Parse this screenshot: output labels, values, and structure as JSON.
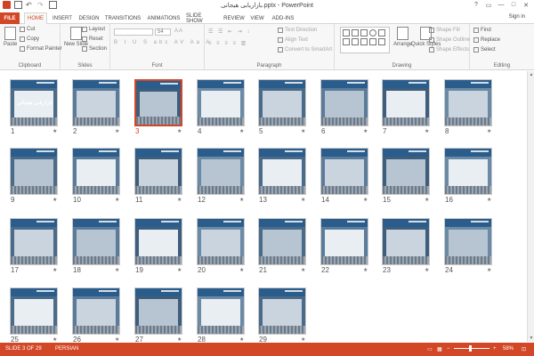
{
  "window": {
    "title": "بازاریابی هیجانی.pptx - PowerPoint",
    "controls": [
      "?",
      "▭",
      "—",
      "□",
      "✕"
    ]
  },
  "tabs": [
    {
      "label": "FILE"
    },
    {
      "label": "HOME"
    },
    {
      "label": "INSERT"
    },
    {
      "label": "DESIGN"
    },
    {
      "label": "TRANSITIONS"
    },
    {
      "label": "ANIMATIONS"
    },
    {
      "label": "SLIDE SHOW"
    },
    {
      "label": "REVIEW"
    },
    {
      "label": "VIEW"
    },
    {
      "label": "ADD-INS"
    }
  ],
  "signin": "Sign in",
  "ribbon": {
    "clipboard": {
      "label": "Clipboard",
      "paste": "Paste",
      "cut": "Cut",
      "copy": "Copy",
      "format_painter": "Format Painter"
    },
    "slides": {
      "label": "Slides",
      "new_slide": "New Slide",
      "layout": "Layout",
      "reset": "Reset",
      "section": "Section"
    },
    "font": {
      "label": "Font",
      "size": "54"
    },
    "paragraph": {
      "label": "Paragraph",
      "text_direction": "Text Direction",
      "align_text": "Align Text",
      "convert_smartart": "Convert to SmartArt"
    },
    "drawing": {
      "label": "Drawing",
      "arrange": "Arrange",
      "quick_styles": "Quick Styles",
      "shape_fill": "Shape Fill",
      "shape_outline": "Shape Outline",
      "shape_effects": "Shape Effects"
    },
    "editing": {
      "label": "Editing",
      "find": "Find",
      "replace": "Replace",
      "select": "Select"
    }
  },
  "slides": [
    {
      "n": "1"
    },
    {
      "n": "2"
    },
    {
      "n": "3"
    },
    {
      "n": "4"
    },
    {
      "n": "5"
    },
    {
      "n": "6"
    },
    {
      "n": "7"
    },
    {
      "n": "8"
    },
    {
      "n": "9"
    },
    {
      "n": "10"
    },
    {
      "n": "11"
    },
    {
      "n": "12"
    },
    {
      "n": "13"
    },
    {
      "n": "14"
    },
    {
      "n": "15"
    },
    {
      "n": "16"
    },
    {
      "n": "17"
    },
    {
      "n": "18"
    },
    {
      "n": "19"
    },
    {
      "n": "20"
    },
    {
      "n": "21"
    },
    {
      "n": "22"
    },
    {
      "n": "23"
    },
    {
      "n": "24"
    },
    {
      "n": "25"
    },
    {
      "n": "26"
    },
    {
      "n": "27"
    },
    {
      "n": "28"
    },
    {
      "n": "29"
    }
  ],
  "selected_slide": "3",
  "title_slide_text": "بازاریابی هیجانی",
  "status": {
    "slide_info": "SLIDE 3 OF 29",
    "language": "PERSIAN",
    "zoom": "58%"
  },
  "colors": {
    "accent": "#d24726",
    "slide_header": "#2b5d8c"
  }
}
